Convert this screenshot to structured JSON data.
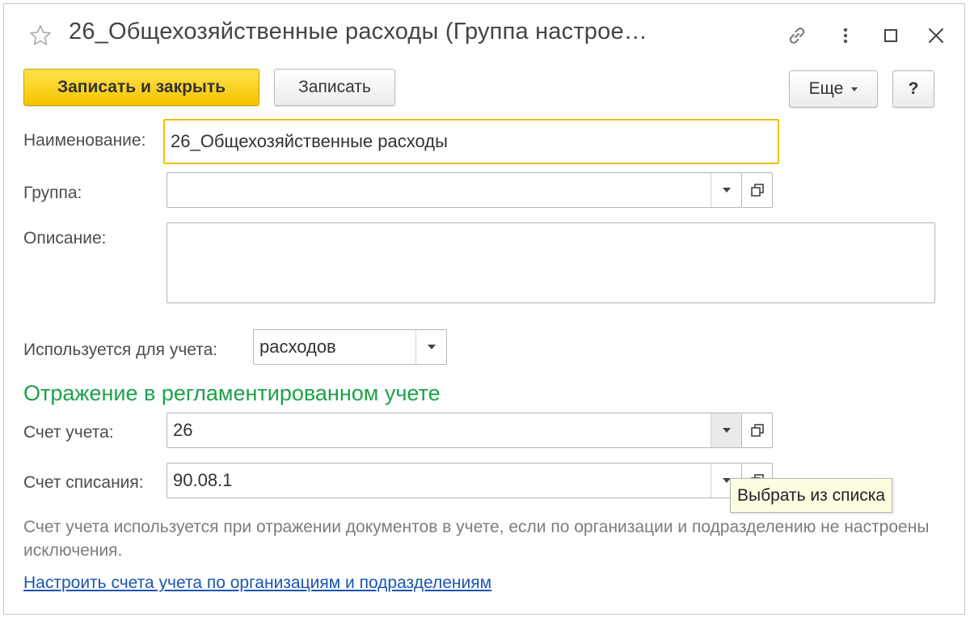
{
  "window": {
    "title": "26_Общехозяйственные расходы (Группа настрое…"
  },
  "toolbar": {
    "save_close_label": "Записать и закрыть",
    "save_label": "Записать",
    "more_label": "Еще",
    "help_label": "?"
  },
  "form": {
    "name_label": "Наименование:",
    "name_value": "26_Общехозяйственные расходы",
    "group_label": "Группа:",
    "group_value": "",
    "description_label": "Описание:",
    "description_value": "",
    "used_for_label": "Используется для учета:",
    "used_for_value": "расходов"
  },
  "section": {
    "title": "Отражение в регламентированном учете",
    "account_label": "Счет учета:",
    "account_value": "26",
    "writeoff_label": "Счет списания:",
    "writeoff_value": "90.08.1",
    "hint_text": "Счет учета используется при отражении документов в учете, если по организации и подразделению не настроены исключения.",
    "link_text": "Настроить счета учета по организациям и подразделениям"
  },
  "tooltip": {
    "text": "Выбрать из списка"
  },
  "colors": {
    "primary_button": "#f5c400",
    "section_title": "#1da14a",
    "link": "#1b55b0",
    "focus_border": "#f0c000"
  }
}
